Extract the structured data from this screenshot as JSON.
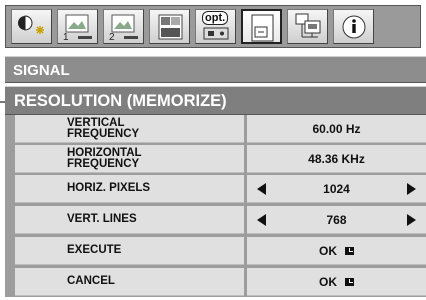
{
  "tabs": [
    {
      "icon": "picture-adjust-icon"
    },
    {
      "icon": "image-1-icon",
      "num": "1"
    },
    {
      "icon": "image-2-icon",
      "num": "2"
    },
    {
      "icon": "installation-icon"
    },
    {
      "icon": "options-icon",
      "label": "opt."
    },
    {
      "icon": "signal-icon",
      "selected": true
    },
    {
      "icon": "network-icon"
    },
    {
      "icon": "info-icon"
    }
  ],
  "menu": {
    "section": "SIGNAL",
    "submenu": "RESOLUTION (MEMORIZE)",
    "rows": [
      {
        "label": "VERTICAL\nFREQUENCY",
        "value": "60.00 Hz"
      },
      {
        "label": "HORIZONTAL\nFREQUENCY",
        "value": "48.36 KHz"
      },
      {
        "label": "HORIZ. PIXELS",
        "value": "1024"
      },
      {
        "label": "VERT. LINES",
        "value": "768"
      },
      {
        "label": "EXECUTE",
        "value": "OK"
      },
      {
        "label": "CANCEL",
        "value": "OK"
      }
    ]
  }
}
